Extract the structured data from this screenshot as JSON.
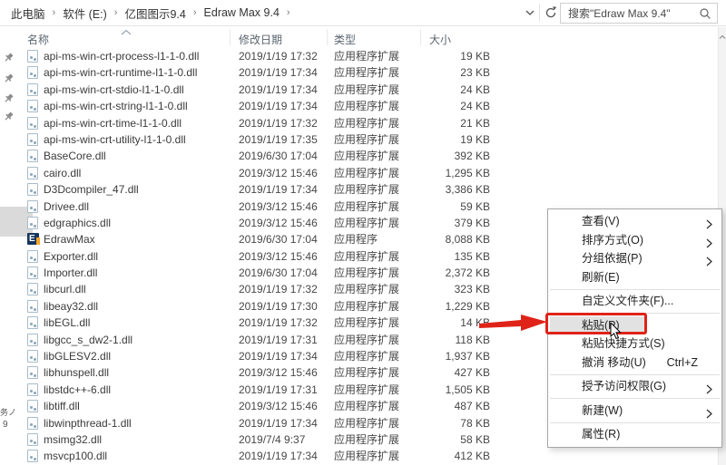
{
  "breadcrumb": {
    "items": [
      "此电脑",
      "软件 (E:)",
      "亿图图示9.4",
      "Edraw Max 9.4"
    ],
    "separator": "›"
  },
  "toolbar": {
    "search_placeholder": "搜索\"Edraw Max 9.4\""
  },
  "columns": {
    "name": "名称",
    "date": "修改日期",
    "type": "类型",
    "size": "大小"
  },
  "rows": [
    {
      "icon": "dll",
      "name": "api-ms-win-crt-process-l1-1-0.dll",
      "date": "2019/1/19 17:32",
      "type": "应用程序扩展",
      "size": "19 KB"
    },
    {
      "icon": "dll",
      "name": "api-ms-win-crt-runtime-l1-1-0.dll",
      "date": "2019/1/19 17:34",
      "type": "应用程序扩展",
      "size": "23 KB"
    },
    {
      "icon": "dll",
      "name": "api-ms-win-crt-stdio-l1-1-0.dll",
      "date": "2019/1/19 17:34",
      "type": "应用程序扩展",
      "size": "24 KB"
    },
    {
      "icon": "dll",
      "name": "api-ms-win-crt-string-l1-1-0.dll",
      "date": "2019/1/19 17:34",
      "type": "应用程序扩展",
      "size": "24 KB"
    },
    {
      "icon": "dll",
      "name": "api-ms-win-crt-time-l1-1-0.dll",
      "date": "2019/1/19 17:32",
      "type": "应用程序扩展",
      "size": "21 KB"
    },
    {
      "icon": "dll",
      "name": "api-ms-win-crt-utility-l1-1-0.dll",
      "date": "2019/1/19 17:35",
      "type": "应用程序扩展",
      "size": "19 KB"
    },
    {
      "icon": "dll",
      "name": "BaseCore.dll",
      "date": "2019/6/30 17:04",
      "type": "应用程序扩展",
      "size": "392 KB"
    },
    {
      "icon": "dll",
      "name": "cairo.dll",
      "date": "2019/3/12 15:46",
      "type": "应用程序扩展",
      "size": "1,295 KB"
    },
    {
      "icon": "dll",
      "name": "D3Dcompiler_47.dll",
      "date": "2019/1/19 17:34",
      "type": "应用程序扩展",
      "size": "3,386 KB"
    },
    {
      "icon": "dll",
      "name": "Drivee.dll",
      "date": "2019/3/12 15:46",
      "type": "应用程序扩展",
      "size": "59 KB"
    },
    {
      "icon": "dll",
      "name": "edgraphics.dll",
      "date": "2019/3/12 15:46",
      "type": "应用程序扩展",
      "size": "379 KB"
    },
    {
      "icon": "edraw",
      "name": "EdrawMax",
      "date": "2019/6/30 17:04",
      "type": "应用程序",
      "size": "8,088 KB"
    },
    {
      "icon": "dll",
      "name": "Exporter.dll",
      "date": "2019/3/12 15:46",
      "type": "应用程序扩展",
      "size": "135 KB"
    },
    {
      "icon": "dll",
      "name": "Importer.dll",
      "date": "2019/6/30 17:04",
      "type": "应用程序扩展",
      "size": "2,372 KB"
    },
    {
      "icon": "dll",
      "name": "libcurl.dll",
      "date": "2019/1/19 17:32",
      "type": "应用程序扩展",
      "size": "323 KB"
    },
    {
      "icon": "dll",
      "name": "libeay32.dll",
      "date": "2019/1/19 17:30",
      "type": "应用程序扩展",
      "size": "1,229 KB"
    },
    {
      "icon": "dll",
      "name": "libEGL.dll",
      "date": "2019/1/19 17:32",
      "type": "应用程序扩展",
      "size": "14 KB"
    },
    {
      "icon": "dll",
      "name": "libgcc_s_dw2-1.dll",
      "date": "2019/1/19 17:31",
      "type": "应用程序扩展",
      "size": "118 KB"
    },
    {
      "icon": "dll",
      "name": "libGLESV2.dll",
      "date": "2019/1/19 17:34",
      "type": "应用程序扩展",
      "size": "1,937 KB"
    },
    {
      "icon": "dll",
      "name": "libhunspell.dll",
      "date": "2019/3/12 15:46",
      "type": "应用程序扩展",
      "size": "427 KB"
    },
    {
      "icon": "dll",
      "name": "libstdc++-6.dll",
      "date": "2019/1/19 17:31",
      "type": "应用程序扩展",
      "size": "1,505 KB"
    },
    {
      "icon": "dll",
      "name": "libtiff.dll",
      "date": "2019/3/12 15:46",
      "type": "应用程序扩展",
      "size": "487 KB"
    },
    {
      "icon": "dll",
      "name": "libwinpthread-1.dll",
      "date": "2019/1/19 17:34",
      "type": "应用程序扩展",
      "size": "78 KB"
    },
    {
      "icon": "dll",
      "name": "msimg32.dll",
      "date": "2019/7/4 9:37",
      "type": "应用程序扩展",
      "size": "58 KB"
    },
    {
      "icon": "dll",
      "name": "msvcp100.dll",
      "date": "2019/1/19 17:34",
      "type": "应用程序扩展",
      "size": "412 KB"
    }
  ],
  "context_menu": {
    "items": [
      {
        "label": "查看(V)",
        "submenu": true
      },
      {
        "label": "排序方式(O)",
        "submenu": true
      },
      {
        "label": "分组依据(P)",
        "submenu": true
      },
      {
        "label": "刷新(E)"
      },
      {
        "separator": true
      },
      {
        "label": "自定义文件夹(F)..."
      },
      {
        "separator": true
      },
      {
        "label": "粘贴(P)",
        "highlighted": true
      },
      {
        "label": "粘贴快捷方式(S)"
      },
      {
        "label": "撤消 移动(U)",
        "shortcut": "Ctrl+Z"
      },
      {
        "separator": true
      },
      {
        "label": "授予访问权限(G)",
        "submenu": true
      },
      {
        "separator": true
      },
      {
        "label": "新建(W)",
        "submenu": true
      },
      {
        "separator": true
      },
      {
        "label": "属性(R)"
      }
    ]
  },
  "left_pane": {
    "fragment_1": "务ノ",
    "fragment_2": "9"
  },
  "colors": {
    "annotation_red": "#df2318",
    "menu_highlight": "#e2e2e2"
  }
}
